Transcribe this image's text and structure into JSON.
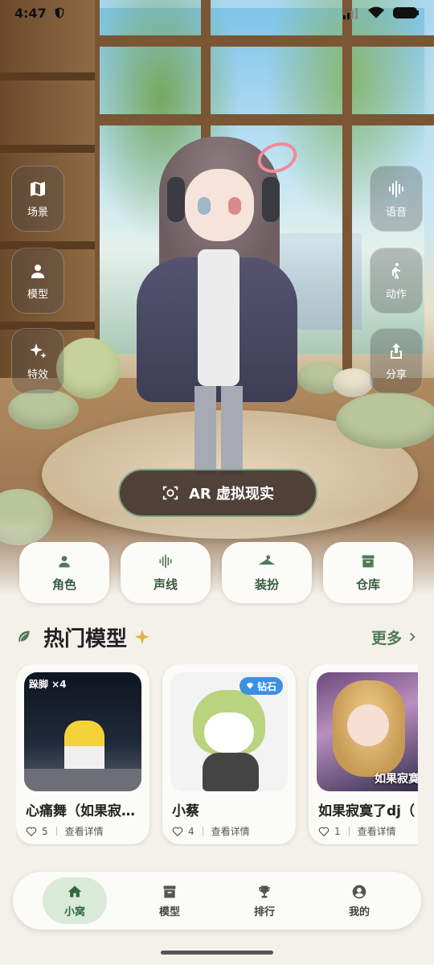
{
  "status_bar": {
    "time": "4:47"
  },
  "side_left": [
    {
      "label": "场景",
      "icon": "map-icon"
    },
    {
      "label": "模型",
      "icon": "person-icon"
    },
    {
      "label": "特效",
      "icon": "sparkle-icon"
    }
  ],
  "side_right": [
    {
      "label": "语音",
      "icon": "voice-wave-icon"
    },
    {
      "label": "动作",
      "icon": "walk-icon"
    },
    {
      "label": "分享",
      "icon": "share-icon"
    }
  ],
  "ar_button": {
    "label": "AR 虚拟现实",
    "icon": "ar-scan-icon"
  },
  "quick_actions": [
    {
      "label": "角色",
      "icon": "person-icon"
    },
    {
      "label": "声线",
      "icon": "voice-wave-icon"
    },
    {
      "label": "装扮",
      "icon": "hanger-icon"
    },
    {
      "label": "仓库",
      "icon": "archive-box-icon"
    }
  ],
  "hot_section": {
    "title": "热门模型",
    "more": "更多"
  },
  "cards": [
    {
      "name": "心痛舞（如果寂寞了dj）",
      "likes": "5",
      "detail": "查看详情",
      "badge": "跺脚 ×4"
    },
    {
      "name": "小蔡",
      "likes": "4",
      "detail": "查看详情",
      "badge": "钻石"
    },
    {
      "name": "如果寂寞了dj（",
      "likes": "1",
      "detail": "查看详情",
      "caption": "如果寂寞了"
    }
  ],
  "bottom_nav": [
    {
      "label": "小窝",
      "icon": "home-icon",
      "active": true
    },
    {
      "label": "模型",
      "icon": "archive-box-icon",
      "active": false
    },
    {
      "label": "排行",
      "icon": "trophy-icon",
      "active": false
    },
    {
      "label": "我的",
      "icon": "account-circle-icon",
      "active": false
    }
  ],
  "colors": {
    "accent": "#4f7a58",
    "active_pill": "#d9ead9",
    "diamond_badge": "#3d8fe0",
    "ar_button": "#3e2e28"
  }
}
